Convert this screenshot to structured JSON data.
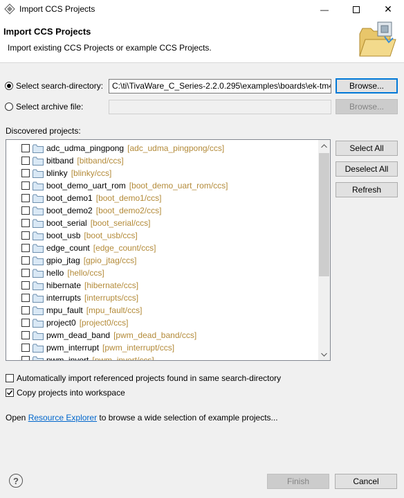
{
  "window": {
    "title": "Import CCS Projects",
    "minimize_glyph": "—",
    "close_glyph": "✕"
  },
  "header": {
    "title": "Import CCS Projects",
    "description": "Import existing CCS Projects or example CCS Projects."
  },
  "search_directory": {
    "label": "Select search-directory:",
    "value": "C:\\ti\\TivaWare_C_Series-2.2.0.295\\examples\\boards\\ek-tm4",
    "browse_label": "Browse...",
    "selected": true
  },
  "archive_file": {
    "label": "Select archive file:",
    "value": "",
    "browse_label": "Browse...",
    "selected": false
  },
  "discovered": {
    "label": "Discovered projects:",
    "projects": [
      {
        "name": "adc_udma_pingpong",
        "path": "[adc_udma_pingpong/ccs]"
      },
      {
        "name": "bitband",
        "path": "[bitband/ccs]"
      },
      {
        "name": "blinky",
        "path": "[blinky/ccs]"
      },
      {
        "name": "boot_demo_uart_rom",
        "path": "[boot_demo_uart_rom/ccs]"
      },
      {
        "name": "boot_demo1",
        "path": "[boot_demo1/ccs]"
      },
      {
        "name": "boot_demo2",
        "path": "[boot_demo2/ccs]"
      },
      {
        "name": "boot_serial",
        "path": "[boot_serial/ccs]"
      },
      {
        "name": "boot_usb",
        "path": "[boot_usb/ccs]"
      },
      {
        "name": "edge_count",
        "path": "[edge_count/ccs]"
      },
      {
        "name": "gpio_jtag",
        "path": "[gpio_jtag/ccs]"
      },
      {
        "name": "hello",
        "path": "[hello/ccs]"
      },
      {
        "name": "hibernate",
        "path": "[hibernate/ccs]"
      },
      {
        "name": "interrupts",
        "path": "[interrupts/ccs]"
      },
      {
        "name": "mpu_fault",
        "path": "[mpu_fault/ccs]"
      },
      {
        "name": "project0",
        "path": "[project0/ccs]"
      },
      {
        "name": "pwm_dead_band",
        "path": "[pwm_dead_band/ccs]"
      },
      {
        "name": "pwm_interrupt",
        "path": "[pwm_interrupt/ccs]"
      },
      {
        "name": "pwm_invert",
        "path": "[pwm_invert/ccs]"
      }
    ]
  },
  "side_buttons": {
    "select_all": "Select All",
    "deselect_all": "Deselect All",
    "refresh": "Refresh"
  },
  "options": {
    "auto_import_label": "Automatically import referenced projects found in same search-directory",
    "auto_import_checked": false,
    "copy_label": "Copy projects into workspace",
    "copy_checked": true
  },
  "footer_text": {
    "prefix": "Open ",
    "link": "Resource Explorer",
    "suffix": " to browse a wide selection of example projects..."
  },
  "bottom_buttons": {
    "help_glyph": "?",
    "finish": "Finish",
    "cancel": "Cancel"
  },
  "colors": {
    "path_text": "#b38a38",
    "link": "#0066cc",
    "focus_border": "#0078d7"
  }
}
